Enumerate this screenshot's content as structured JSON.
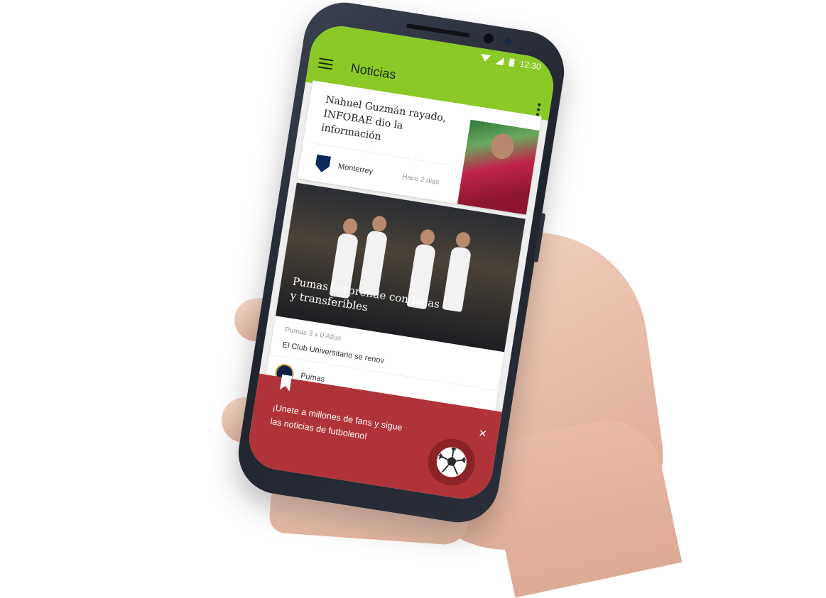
{
  "status_bar": {
    "time": "12:30"
  },
  "app_bar": {
    "title": "Noticias"
  },
  "feed": [
    {
      "headline": "Nahuel Guzmán rayado, INFOBAE dio la información",
      "team": "Monterrey",
      "time_ago": "Hace 2 dias"
    },
    {
      "headline": "Pumas sorprende con bajas y transferibles",
      "score": "Pumas 3 x 0 Atlas",
      "excerpt": "El Club Universitario se renov",
      "team": "Pumas"
    }
  ],
  "promo_banner": {
    "text": "¡Unete a millones de fans y sigue las noticias de futboleno!",
    "close_icon": "close-icon",
    "icon": "soccer-ball-icon",
    "background": "#b0333a"
  },
  "colors": {
    "accent": "#8ac926"
  }
}
